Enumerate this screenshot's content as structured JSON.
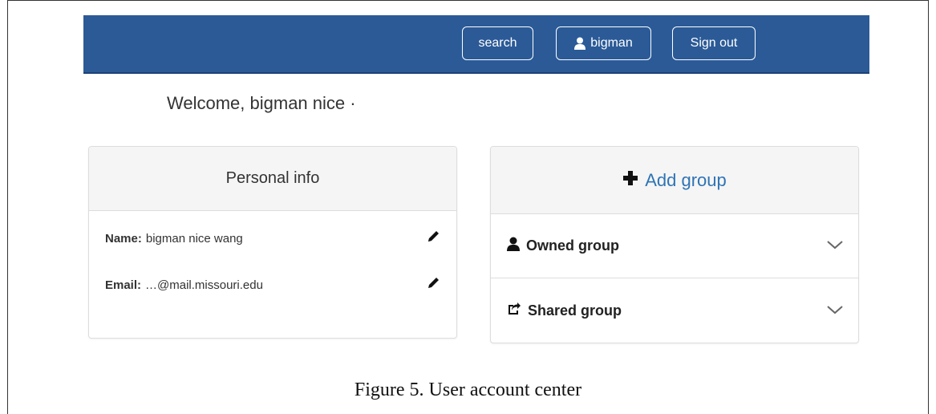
{
  "navbar": {
    "search_label": "search",
    "user_label": "bigman",
    "signout_label": "Sign out",
    "color": "#2b5a97"
  },
  "welcome_text": "Welcome, bigman nice ·",
  "personal_info": {
    "title": "Personal info",
    "name_label": "Name:",
    "name_value": "bigman nice wang",
    "email_label": "Email:",
    "email_value": "…@mail.missouri.edu"
  },
  "groups": {
    "add_label": "Add group",
    "owned_label": "Owned group",
    "shared_label": "Shared group",
    "accent": "#2f74b5"
  },
  "caption": "Figure 5. User account center",
  "icons": [
    "user-icon",
    "pencil-icon",
    "plus-icon",
    "share-icon",
    "chevron-down-icon"
  ]
}
